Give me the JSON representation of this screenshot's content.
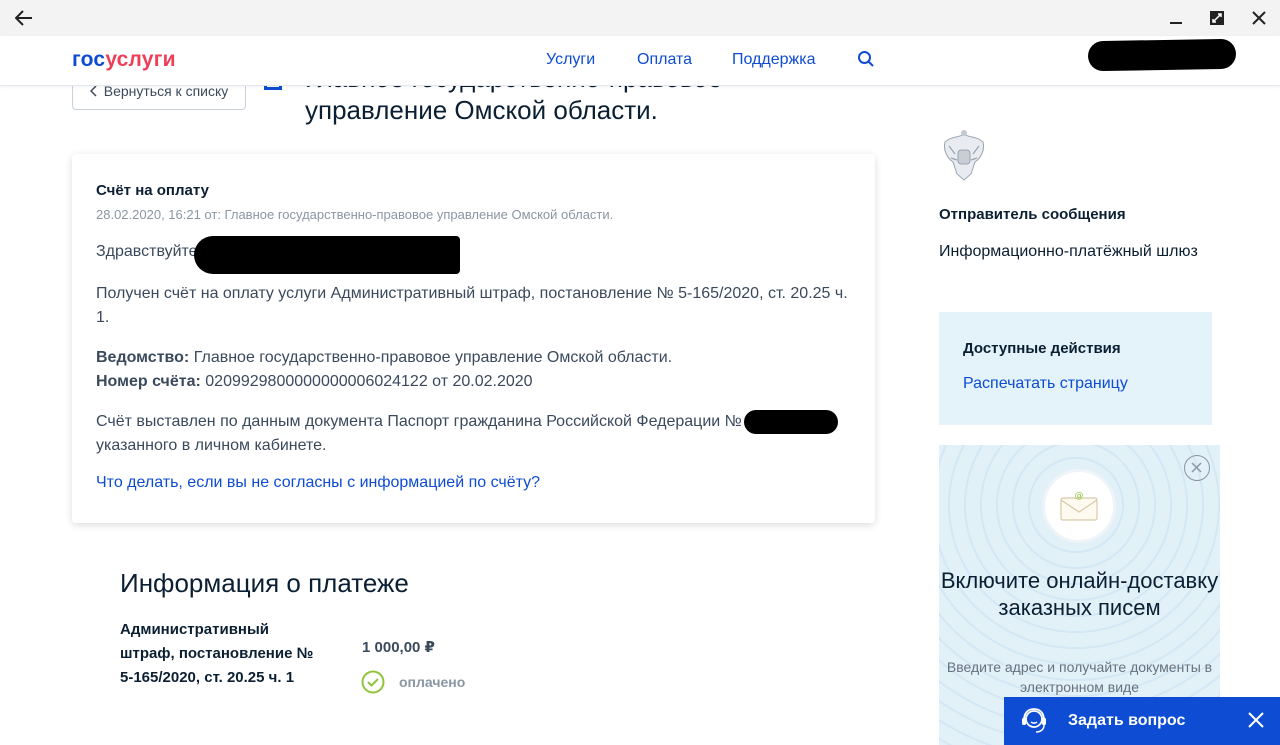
{
  "header": {
    "logo_gos": "гос",
    "logo_uslugi": "услуги",
    "nav": [
      "Услуги",
      "Оплата",
      "Поддержка"
    ]
  },
  "back_button": "Вернуться к списку",
  "page_title": "Главное государственно-правовое управление Омской области.",
  "message": {
    "title": "Счёт на оплату",
    "meta": "28.02.2020, 16:21 от: Главное государственно-правовое управление Омской области.",
    "greeting": "Здравствуйте",
    "body": "Получен счёт на оплату услуги Административный штраф, постановление № 5-165/2020, ст. 20.25 ч. 1.",
    "department_label": "Ведомство:",
    "department_value": "Главное государственно-правовое управление Омской области.",
    "invoice_label": "Номер счёта:",
    "invoice_value": "0209929800000000006024122 от 20.02.2020",
    "document_text_start": "Счёт выставлен по данным документа Паспорт гражданина Российской Федерации №",
    "document_text_end": "указанного в личном кабинете.",
    "disagree_link": "Что делать, если вы не согласны с информацией по счёту?"
  },
  "payment": {
    "title": "Информация о платеже",
    "name": "Административный штраф, постановление № 5-165/2020, ст. 20.25 ч. 1",
    "amount": "1 000,00 ₽",
    "status": "оплачено"
  },
  "sidebar": {
    "sender_title": "Отправитель сообщения",
    "sender_value": "Информационно-платёжный шлюз",
    "actions_title": "Доступные действия",
    "actions_print": "Распечатать страницу"
  },
  "promo": {
    "headline": "Включите онлайн-доставку заказных писем",
    "sub": "Введите адрес и получайте документы в электронном виде"
  },
  "chat": {
    "label": "Задать вопрос"
  },
  "colors": {
    "brand_blue": "#0d4cd3",
    "brand_red": "#ee3f58",
    "paid_green": "#8fc43b"
  }
}
